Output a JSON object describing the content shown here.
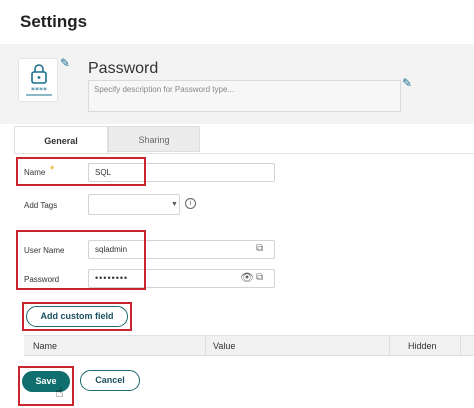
{
  "page": {
    "title": "Settings"
  },
  "header": {
    "type_name": "Password",
    "description_placeholder": "Specify description for Password type...",
    "icon": "lock-icon",
    "edit_icon": "pencil-icon",
    "accent_color": "#1a6f8f"
  },
  "tabs": [
    {
      "label": "General",
      "active": true
    },
    {
      "label": "Sharing",
      "active": false
    }
  ],
  "form": {
    "name_label": "Name",
    "name_value": "SQL",
    "tags_label": "Add Tags",
    "tags_value": "",
    "username_label": "User Name",
    "username_value": "sqladmin",
    "password_label": "Password",
    "password_value": "••••••••"
  },
  "custom_field": {
    "add_label": "Add custom field"
  },
  "table": {
    "columns": [
      "Name",
      "Value",
      "Hidden"
    ]
  },
  "actions": {
    "save_label": "Save",
    "cancel_label": "Cancel",
    "save_color": "#0f6e6e"
  },
  "highlight_color": "#c8252f"
}
